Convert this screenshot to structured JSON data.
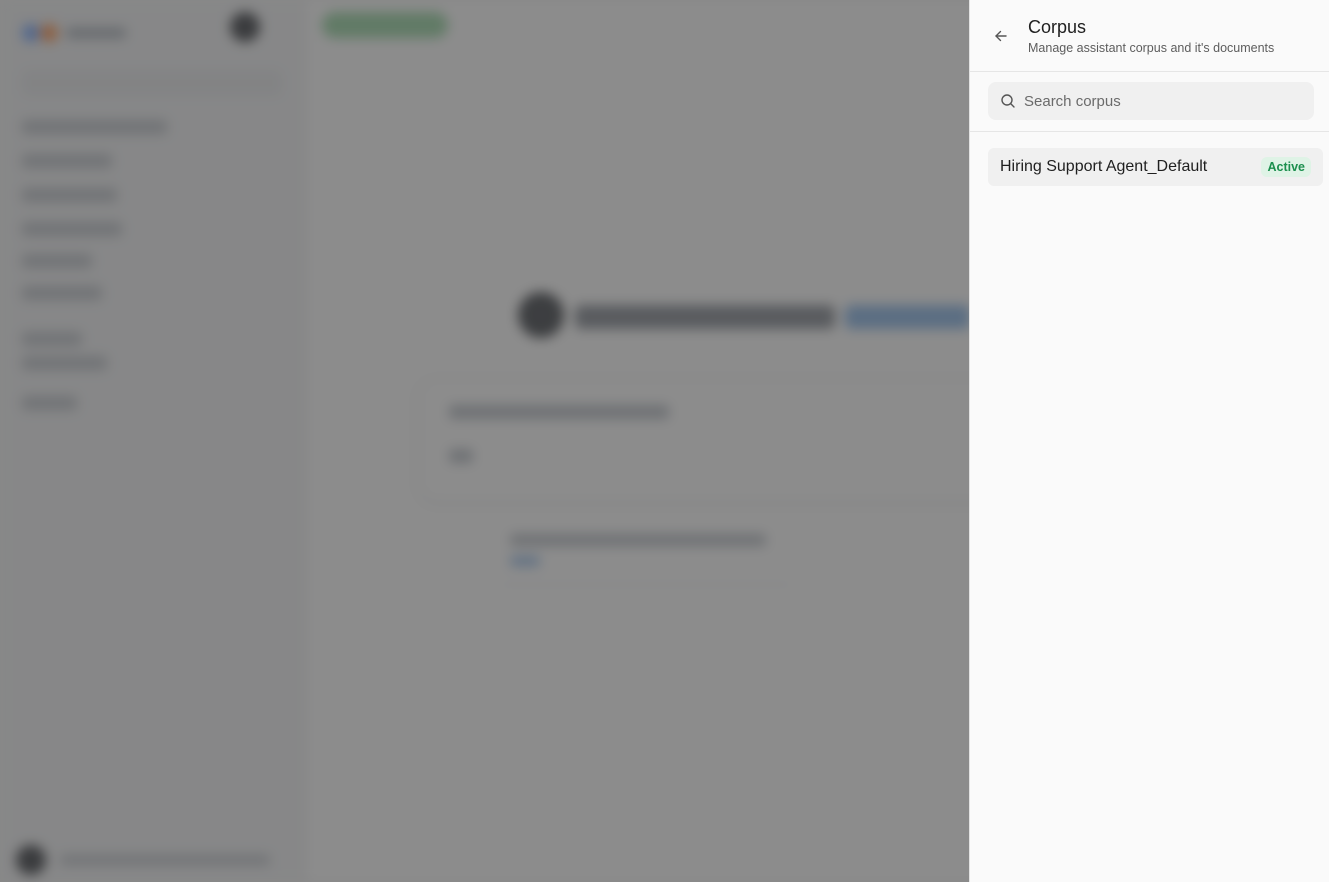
{
  "panel": {
    "title": "Corpus",
    "subtitle": "Manage assistant corpus and it's documents"
  },
  "search": {
    "placeholder": "Search corpus",
    "value": ""
  },
  "corpus_list": [
    {
      "name": "Hiring Support Agent_Default",
      "status": "Active"
    }
  ],
  "icons": {
    "back": "arrow-left-icon",
    "search": "search-icon"
  },
  "colors": {
    "active_badge_bg": "#dff3e6",
    "active_badge_text": "#1c8f4e",
    "overlay": "#464646"
  }
}
